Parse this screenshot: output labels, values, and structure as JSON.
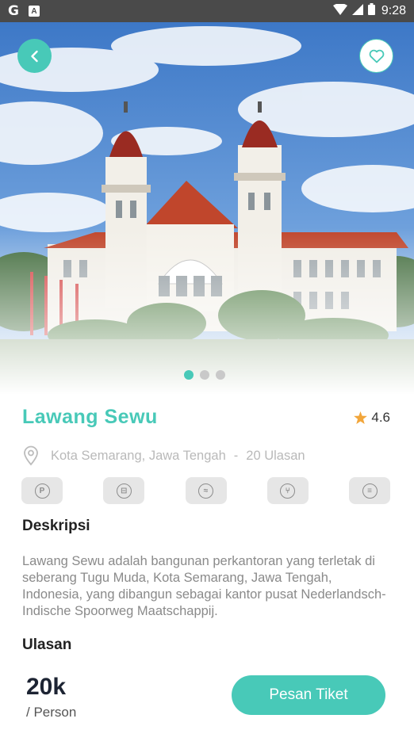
{
  "status_bar": {
    "time": "9:28"
  },
  "place": {
    "title": "Lawang Sewu",
    "rating": "4.6",
    "location": "Kota Semarang, Jawa Tengah",
    "separator": "-",
    "reviews": "20 Ulasan"
  },
  "carousel": {
    "page_count": 3,
    "active_index": 0
  },
  "facilities": [
    {
      "icon": "parking-icon",
      "glyph": "P"
    },
    {
      "icon": "bed-icon",
      "glyph": "⊟"
    },
    {
      "icon": "coffee-icon",
      "glyph": "≈"
    },
    {
      "icon": "restaurant-icon",
      "glyph": "⑂"
    },
    {
      "icon": "toilet-icon",
      "glyph": "≡"
    }
  ],
  "sections": {
    "description_title": "Deskripsi",
    "description": "Lawang Sewu adalah bangunan perkantoran yang terletak di seberang Tugu Muda, Kota Semarang, Jawa Tengah, Indonesia, yang dibangun sebagai kantor pusat Nederlandsch-Indische Spoorweg Maatschappij.",
    "reviews_title": "Ulasan"
  },
  "booking": {
    "price": "20k",
    "unit": "/ Person",
    "button_label": "Pesan Tiket"
  },
  "colors": {
    "accent": "#48c9b8",
    "status_bar": "#4a4a4a",
    "muted_text": "#8a8a8a"
  }
}
